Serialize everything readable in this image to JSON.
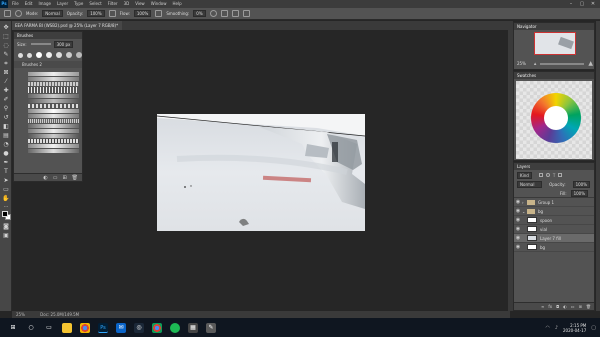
{
  "menubar": {
    "logo": "Ps",
    "items": [
      "File",
      "Edit",
      "Image",
      "Layer",
      "Type",
      "Select",
      "Filter",
      "3D",
      "View",
      "Window",
      "Help"
    ]
  },
  "optbar": {
    "mode_label": "Mode:",
    "mode_value": "Normal",
    "opacity_label": "Opacity:",
    "opacity_value": "100%",
    "flow_label": "Flow:",
    "flow_value": "100%",
    "smoothing_label": "Smoothing:",
    "smoothing_value": "0%"
  },
  "document": {
    "tab_title": "EEA FARMA BI (WSB2).psd @ 25% (Layer 7 RGB/8)*"
  },
  "brushes": {
    "tab_title": "Brushes",
    "size_label": "Size:",
    "size_value": "300 px",
    "folder_name": "Brushes 2"
  },
  "navigator": {
    "tab_title": "Navigator",
    "zoom": "25%"
  },
  "swatches": {
    "tab_title": "Swatches"
  },
  "layers": {
    "tab_title": "Layers",
    "filter_kind": "Kind",
    "blend_mode": "Normal",
    "opacity_label": "Opacity:",
    "opacity_value": "100%",
    "fill_label": "Fill:",
    "fill_value": "100%",
    "rows": [
      {
        "name": "Group 1",
        "type": "group",
        "selected": false
      },
      {
        "name": "bg",
        "type": "group",
        "selected": false
      },
      {
        "name": "spoon",
        "type": "layer",
        "selected": false
      },
      {
        "name": "vial",
        "type": "layer",
        "selected": false
      },
      {
        "name": "Layer 7 fill",
        "type": "layer",
        "selected": true
      },
      {
        "name": "bg",
        "type": "layer",
        "selected": false
      }
    ]
  },
  "statusbar": {
    "zoom": "25%",
    "doc_info": "Doc: 25.0M/149.5M"
  },
  "taskbar": {
    "time": "2:15 PM",
    "date": "2020-04-17",
    "apps": [
      "start",
      "search",
      "task-view",
      "explorer",
      "chrome",
      "photoshop",
      "mail",
      "steam",
      "chrome-2",
      "spotify",
      "calculator",
      "paint"
    ]
  },
  "colors": {
    "accent": "#31a8ff",
    "panel_bg": "#535353",
    "workspace_bg": "#262626"
  }
}
